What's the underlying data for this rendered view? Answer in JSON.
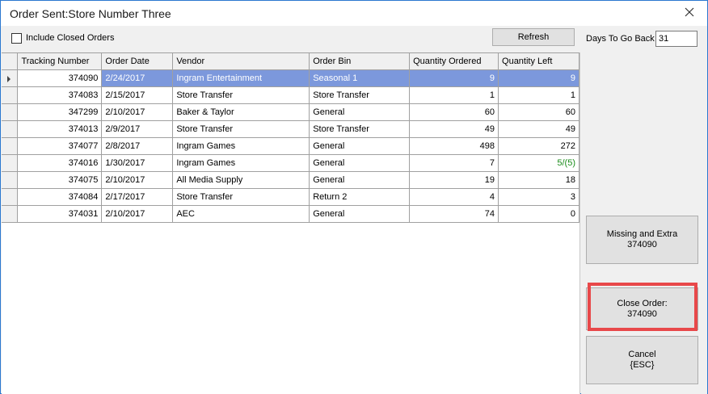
{
  "window": {
    "title": "Order Sent:Store Number Three"
  },
  "toolbar": {
    "include_closed_label": "Include Closed Orders",
    "include_closed_checked": false,
    "refresh_label": "Refresh",
    "days_label": "Days To Go Back",
    "days_value": "31"
  },
  "grid": {
    "columns": [
      "Tracking Number",
      "Order Date",
      "Vendor",
      "Order Bin",
      "Quantity Ordered",
      "Quantity Left"
    ],
    "rows": [
      {
        "tracking": "374090",
        "date": "2/24/2017",
        "vendor": "Ingram Entertainment",
        "bin": "Seasonal 1",
        "ordered": "9",
        "left": "9",
        "selected": true
      },
      {
        "tracking": "374083",
        "date": "2/15/2017",
        "vendor": "Store Transfer",
        "bin": "Store Transfer",
        "ordered": "1",
        "left": "1"
      },
      {
        "tracking": "347299",
        "date": "2/10/2017",
        "vendor": "Baker & Taylor",
        "bin": "General",
        "ordered": "60",
        "left": "60"
      },
      {
        "tracking": "374013",
        "date": "2/9/2017",
        "vendor": "Store Transfer",
        "bin": "Store Transfer",
        "ordered": "49",
        "left": "49"
      },
      {
        "tracking": "374077",
        "date": "2/8/2017",
        "vendor": "Ingram Games",
        "bin": "General",
        "ordered": "498",
        "left": "272"
      },
      {
        "tracking": "374016",
        "date": "1/30/2017",
        "vendor": "Ingram Games",
        "bin": "General",
        "ordered": "7",
        "left": "5/(5)",
        "left_color": "#1a8c1a"
      },
      {
        "tracking": "374075",
        "date": "2/10/2017",
        "vendor": "All Media Supply",
        "bin": "General",
        "ordered": "19",
        "left": "18"
      },
      {
        "tracking": "374084",
        "date": "2/17/2017",
        "vendor": "Store Transfer",
        "bin": "Return 2",
        "ordered": "4",
        "left": "3"
      },
      {
        "tracking": "374031",
        "date": "2/10/2017",
        "vendor": "AEC",
        "bin": "General",
        "ordered": "74",
        "left": "0"
      }
    ]
  },
  "side": {
    "missing_line1": "Missing and Extra",
    "missing_line2": "374090",
    "close_line1": "Close Order:",
    "close_line2": "374090",
    "cancel_line1": "Cancel",
    "cancel_line2": "{ESC}"
  },
  "colors": {
    "selection": "#7c98dc",
    "highlight": "#e8484a",
    "green_text": "#1a8c1a",
    "window_border": "#2b78d0"
  },
  "icons": {
    "close": "close-icon",
    "row_pointer": "row-pointer-icon"
  }
}
